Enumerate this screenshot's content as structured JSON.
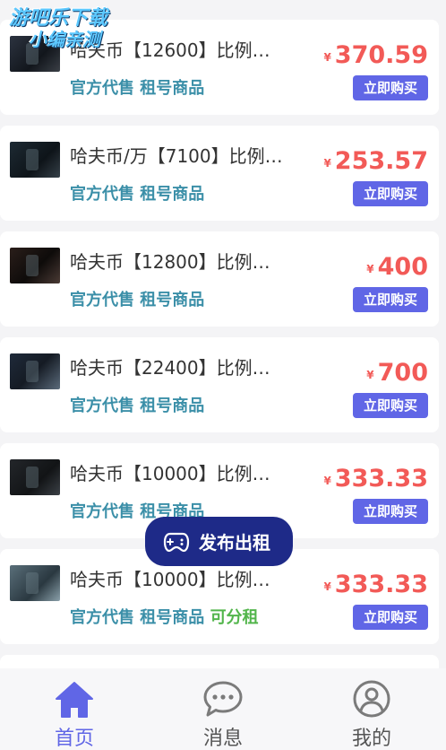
{
  "watermark": {
    "line1": "游吧乐下载",
    "line2": "小编亲测"
  },
  "products": [
    {
      "title": "哈夫币【12600】比例…",
      "tag1": "官方代售",
      "tag2": "租号商品",
      "tag3": "",
      "currency": "¥",
      "price": "370.59",
      "buy_label": "立即购买"
    },
    {
      "title": "哈夫币/万【7100】比例…",
      "tag1": "官方代售",
      "tag2": "租号商品",
      "tag3": "",
      "currency": "¥",
      "price": "253.57",
      "buy_label": "立即购买"
    },
    {
      "title": "哈夫币【12800】比例…",
      "tag1": "官方代售",
      "tag2": "租号商品",
      "tag3": "",
      "currency": "¥",
      "price": "400",
      "buy_label": "立即购买"
    },
    {
      "title": "哈夫币【22400】比例…",
      "tag1": "官方代售",
      "tag2": "租号商品",
      "tag3": "",
      "currency": "¥",
      "price": "700",
      "buy_label": "立即购买"
    },
    {
      "title": "哈夫币【10000】比例…",
      "tag1": "官方代售",
      "tag2": "租号商品",
      "tag3": "",
      "currency": "¥",
      "price": "333.33",
      "buy_label": "立即购买"
    },
    {
      "title": "哈夫币【10000】比例…",
      "tag1": "官方代售",
      "tag2": "租号商品",
      "tag3": "可分租",
      "currency": "¥",
      "price": "333.33",
      "buy_label": "立即购买"
    }
  ],
  "fab": {
    "label": "发布出租",
    "icon": "gamepad-icon"
  },
  "tabbar": [
    {
      "label": "首页",
      "icon": "home-icon",
      "active": true
    },
    {
      "label": "消息",
      "icon": "message-icon",
      "active": false
    },
    {
      "label": "我的",
      "icon": "profile-icon",
      "active": false
    }
  ],
  "colors": {
    "accent": "#6066e6",
    "price": "#f25a57",
    "tag": "#3b8fa8",
    "tag_green": "#52b54b",
    "fab_bg": "#1e2a88"
  }
}
